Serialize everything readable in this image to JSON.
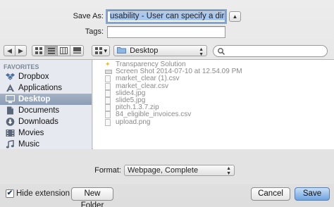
{
  "save_as": {
    "label": "Save As:",
    "value": "usability - User can specify a directory",
    "expand_glyph": "▲"
  },
  "tags": {
    "label": "Tags:",
    "value": ""
  },
  "toolbar": {
    "back_glyph": "◀",
    "forward_glyph": "▶",
    "location": "Desktop",
    "arrange_glyph": "▾",
    "search_value": ""
  },
  "sidebar": {
    "heading": "FAVORITES",
    "items": [
      {
        "label": "Dropbox",
        "icon": "dropbox-icon",
        "selected": false
      },
      {
        "label": "Applications",
        "icon": "applications-icon",
        "selected": false
      },
      {
        "label": "Desktop",
        "icon": "desktop-icon",
        "selected": true
      },
      {
        "label": "Documents",
        "icon": "documents-icon",
        "selected": false
      },
      {
        "label": "Downloads",
        "icon": "downloads-icon",
        "selected": false
      },
      {
        "label": "Movies",
        "icon": "movies-icon",
        "selected": false
      },
      {
        "label": "Music",
        "icon": "music-icon",
        "selected": false
      }
    ]
  },
  "files": [
    {
      "name": "Transparency Solution",
      "kind": "app"
    },
    {
      "name": "Screen Shot 2014-07-10 at 12.54.09 PM",
      "kind": "img"
    },
    {
      "name": "market_clear (1).csv",
      "kind": "doc"
    },
    {
      "name": "market_clear.csv",
      "kind": "doc"
    },
    {
      "name": "slide4.jpg",
      "kind": "doc"
    },
    {
      "name": "slide5.jpg",
      "kind": "doc"
    },
    {
      "name": "pitch.1.3.7.zip",
      "kind": "doc"
    },
    {
      "name": "84_eligible_invoices.csv",
      "kind": "doc"
    },
    {
      "name": "upload.png",
      "kind": "doc"
    }
  ],
  "format": {
    "label": "Format:",
    "value": "Webpage, Complete"
  },
  "hide_extension": {
    "label": "Hide extension",
    "checked": true,
    "check_glyph": "✔"
  },
  "buttons": {
    "new_folder": "New Folder",
    "cancel": "Cancel",
    "save": "Save"
  },
  "colors": {
    "selection": "#8c9db4",
    "default_button": "#6ea3e0",
    "sidebar_bg": "#e6eaf0"
  }
}
